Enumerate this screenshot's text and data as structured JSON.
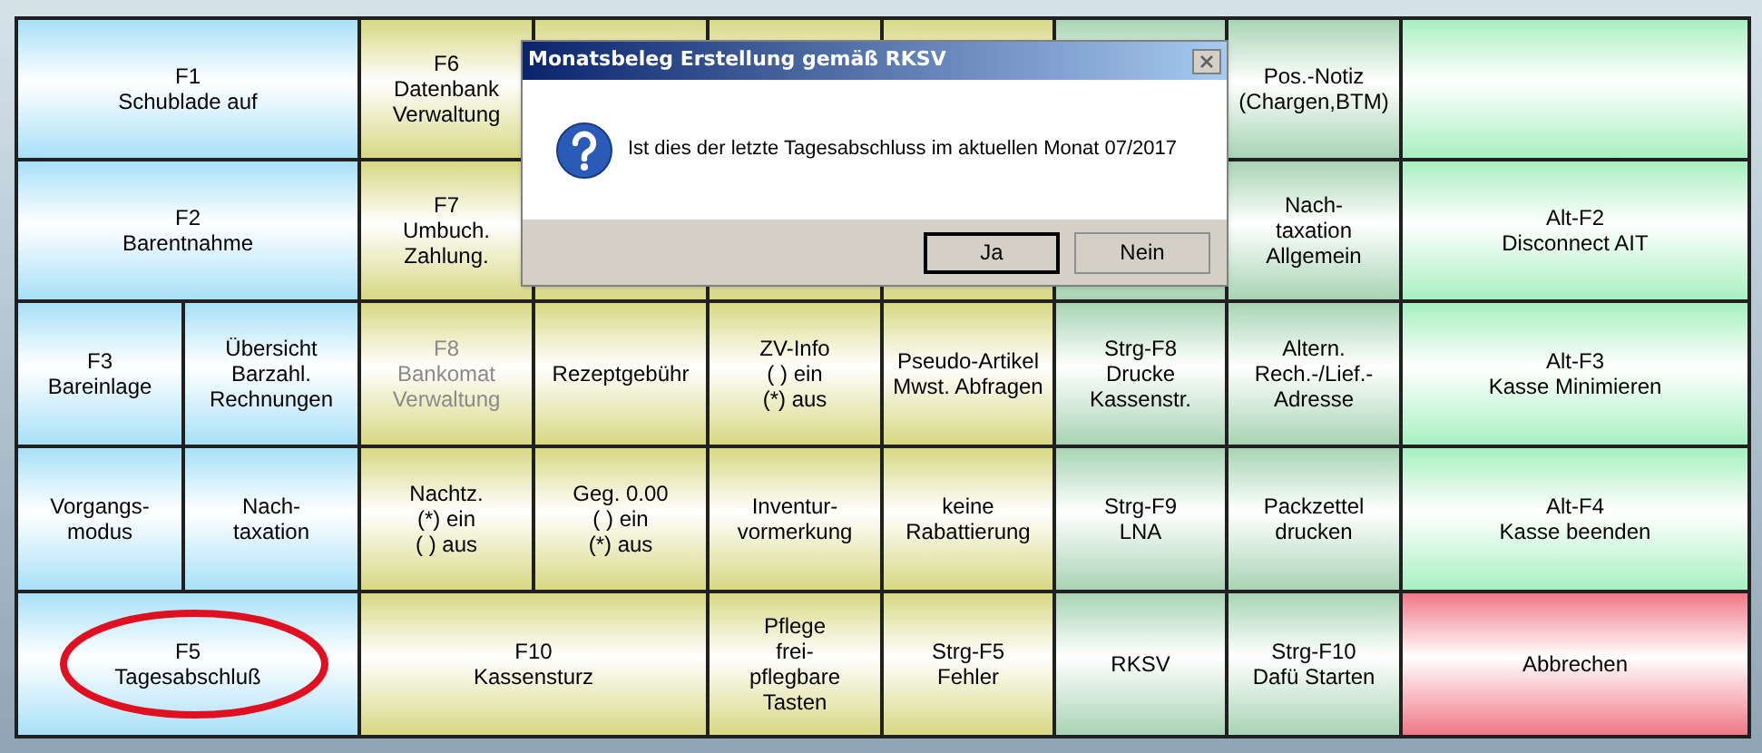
{
  "rows": [
    {
      "keys": [
        {
          "lines": [
            "F1",
            "Schublade auf"
          ],
          "color": "#a8e0f8",
          "disabled": false,
          "circled": false
        },
        {
          "lines": [
            "F6",
            "Datenbank",
            "Verwaltung"
          ],
          "color": "#d8d884",
          "disabled": false,
          "circled": false
        },
        {
          "color": "#d8d884"
        },
        {
          "color": "#d8d884"
        },
        {
          "color": "#d8d884"
        },
        {
          "color": "#a8d4b4"
        },
        {
          "lines": [
            "Pos.-Notiz",
            "(Chargen,BTM)"
          ],
          "color": "#a8d4b4",
          "disabled": false,
          "circled": false
        },
        {
          "color": "#a8f0c0"
        }
      ]
    },
    {
      "keys": [
        {
          "lines": [
            "F2",
            "Barentnahme"
          ],
          "color": "#a8e0f8",
          "disabled": false,
          "circled": false
        },
        {
          "lines": [
            "F7",
            "Umbuch.",
            "Zahlung."
          ],
          "color": "#d8d884",
          "disabled": false,
          "circled": false
        },
        {
          "color": "#d8d884"
        },
        {
          "color": "#d8d884"
        },
        {
          "color": "#d8d884"
        },
        {
          "color": "#a8d4b4"
        },
        {
          "lines": [
            "Nach-",
            "taxation",
            "Allgemein"
          ],
          "color": "#a8d4b4",
          "disabled": false,
          "circled": false
        },
        {
          "lines": [
            "Alt-F2",
            "Disconnect AIT"
          ],
          "color": "#a8f0c0",
          "disabled": false,
          "circled": false
        }
      ]
    },
    {
      "keys": [
        {
          "lines": [
            "F3",
            "Bareinlage"
          ],
          "color": "#a8e0f8",
          "disabled": false,
          "circled": false
        },
        {
          "lines": [
            "Übersicht",
            "Barzahl.",
            "Rechnungen"
          ],
          "color": "#a8e0f8",
          "disabled": false,
          "circled": false
        },
        {
          "lines": [
            "F8",
            "Bankomat",
            "Verwaltung"
          ],
          "color": "#d8d884",
          "disabled": true,
          "circled": false
        },
        {
          "lines": [
            "Rezeptgebühr"
          ],
          "color": "#d8d884",
          "disabled": false,
          "circled": false
        },
        {
          "lines": [
            "ZV-Info",
            "( ) ein",
            "(*) aus"
          ],
          "color": "#d8d884",
          "disabled": false,
          "circled": false
        },
        {
          "lines": [
            "Pseudo-Artikel",
            "Mwst. Abfragen"
          ],
          "color": "#d8d884",
          "disabled": false,
          "circled": false
        },
        {
          "lines": [
            "Strg-F8",
            "Drucke",
            "Kassenstr."
          ],
          "color": "#a8d4b4",
          "disabled": false,
          "circled": false
        },
        {
          "lines": [
            "Altern.",
            "Rech.-/Lief.-",
            "Adresse"
          ],
          "color": "#a8d4b4",
          "disabled": false,
          "circled": false
        },
        {
          "lines": [
            "Alt-F3",
            "Kasse Minimieren"
          ],
          "color": "#a8f0c0",
          "disabled": false,
          "circled": false
        }
      ]
    },
    {
      "keys": [
        {
          "lines": [
            "Vorgangs-",
            "modus"
          ],
          "color": "#a8e0f8",
          "disabled": false,
          "circled": false
        },
        {
          "lines": [
            "Nach-",
            "taxation"
          ],
          "color": "#a8e0f8",
          "disabled": false,
          "circled": false
        },
        {
          "lines": [
            "Nachtz.",
            "(*) ein",
            "( ) aus"
          ],
          "color": "#d8d884",
          "disabled": false,
          "circled": false
        },
        {
          "lines": [
            "Geg. 0.00",
            "( ) ein",
            "(*) aus"
          ],
          "color": "#d8d884",
          "disabled": false,
          "circled": false
        },
        {
          "lines": [
            "Inventur-",
            "vormerkung"
          ],
          "color": "#d8d884",
          "disabled": false,
          "circled": false
        },
        {
          "lines": [
            "keine",
            "Rabattierung"
          ],
          "color": "#d8d884",
          "disabled": false,
          "circled": false
        },
        {
          "lines": [
            "Strg-F9",
            "LNA"
          ],
          "color": "#a8d4b4",
          "disabled": false,
          "circled": false
        },
        {
          "lines": [
            "Packzettel",
            "drucken"
          ],
          "color": "#a8d4b4",
          "disabled": false,
          "circled": false
        },
        {
          "lines": [
            "Alt-F4",
            "Kasse beenden"
          ],
          "color": "#a8f0c0",
          "disabled": false,
          "circled": false
        }
      ]
    },
    {
      "keys": [
        {
          "lines": [
            "F5",
            "Tagesabschluß"
          ],
          "color": "#a8e0f8",
          "disabled": false,
          "circled": true
        },
        {
          "lines": [
            "F10",
            "Kassensturz"
          ],
          "color": "#d8d884",
          "disabled": false,
          "circled": false
        },
        {
          "lines": [
            "Pflege",
            "frei-",
            "pflegbare",
            "Tasten"
          ],
          "color": "#d8d884",
          "disabled": false,
          "circled": false
        },
        {
          "lines": [
            "Strg-F5",
            "Fehler"
          ],
          "color": "#d8d884",
          "disabled": false,
          "circled": false
        },
        {
          "lines": [
            "RKSV"
          ],
          "color": "#a8d4b4",
          "disabled": false,
          "circled": false
        },
        {
          "lines": [
            "Strg-F10",
            "Dafü Starten"
          ],
          "color": "#a8d4b4",
          "disabled": false,
          "circled": false
        },
        {
          "lines": [
            "Abbrechen"
          ],
          "color": "#f07888",
          "disabled": false,
          "circled": false
        }
      ]
    }
  ],
  "dialog": {
    "title": "Monatsbeleg Erstellung gemäß RKSV",
    "message": "Ist dies der letzte Tagesabschluss im aktuellen Monat 07/2017",
    "buttons": [
      {
        "label": "Ja",
        "selected": true
      },
      {
        "label": "Nein",
        "selected": false
      }
    ]
  }
}
